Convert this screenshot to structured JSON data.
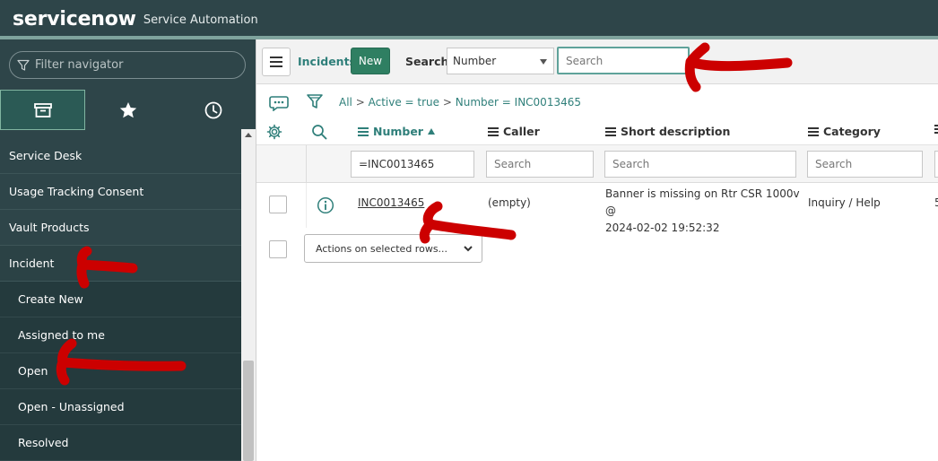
{
  "banner": {
    "logo": "servicenow",
    "app_title": "Service Automation"
  },
  "navigator": {
    "filter_placeholder": "Filter navigator",
    "tabs": [
      {
        "name": "all-applications",
        "icon": "archive-box-icon"
      },
      {
        "name": "favorites",
        "icon": "star-icon"
      },
      {
        "name": "history",
        "icon": "clock-icon"
      }
    ],
    "items": [
      {
        "label": "Service Desk",
        "level": 0
      },
      {
        "label": "Usage Tracking Consent",
        "level": 0
      },
      {
        "label": "Vault Products",
        "level": 0
      },
      {
        "label": "Incident",
        "level": 0
      },
      {
        "label": "Create New",
        "level": 1
      },
      {
        "label": "Assigned to me",
        "level": 1
      },
      {
        "label": "Open",
        "level": 1
      },
      {
        "label": "Open - Unassigned",
        "level": 1
      },
      {
        "label": "Resolved",
        "level": 1
      }
    ]
  },
  "list": {
    "title": "Incidents",
    "new_label": "New",
    "search_label": "Search",
    "search_field": "Number",
    "search_placeholder": "Search",
    "breadcrumb": {
      "all": "All",
      "sep": ">",
      "c1": "Active = true",
      "c2": "Number = INC0013465"
    },
    "columns": {
      "number": "Number",
      "caller": "Caller",
      "short_description": "Short description",
      "category": "Category"
    },
    "filters": {
      "number_value": "=INC0013465",
      "placeholder": "Search"
    },
    "row": {
      "number": "INC0013465",
      "caller": "(empty)",
      "short_description_line1": "Banner is missing on Rtr CSR 1000v @",
      "short_description_line2": "2024-02-02 19:52:32",
      "category": "Inquiry / Help",
      "overflow": "5"
    },
    "actions_label": "Actions on selected rows..."
  },
  "colors": {
    "banner": "#2e4549",
    "accent": "#2f7f7a",
    "new_button": "#2f7f62",
    "annotation": "#cc0000"
  }
}
